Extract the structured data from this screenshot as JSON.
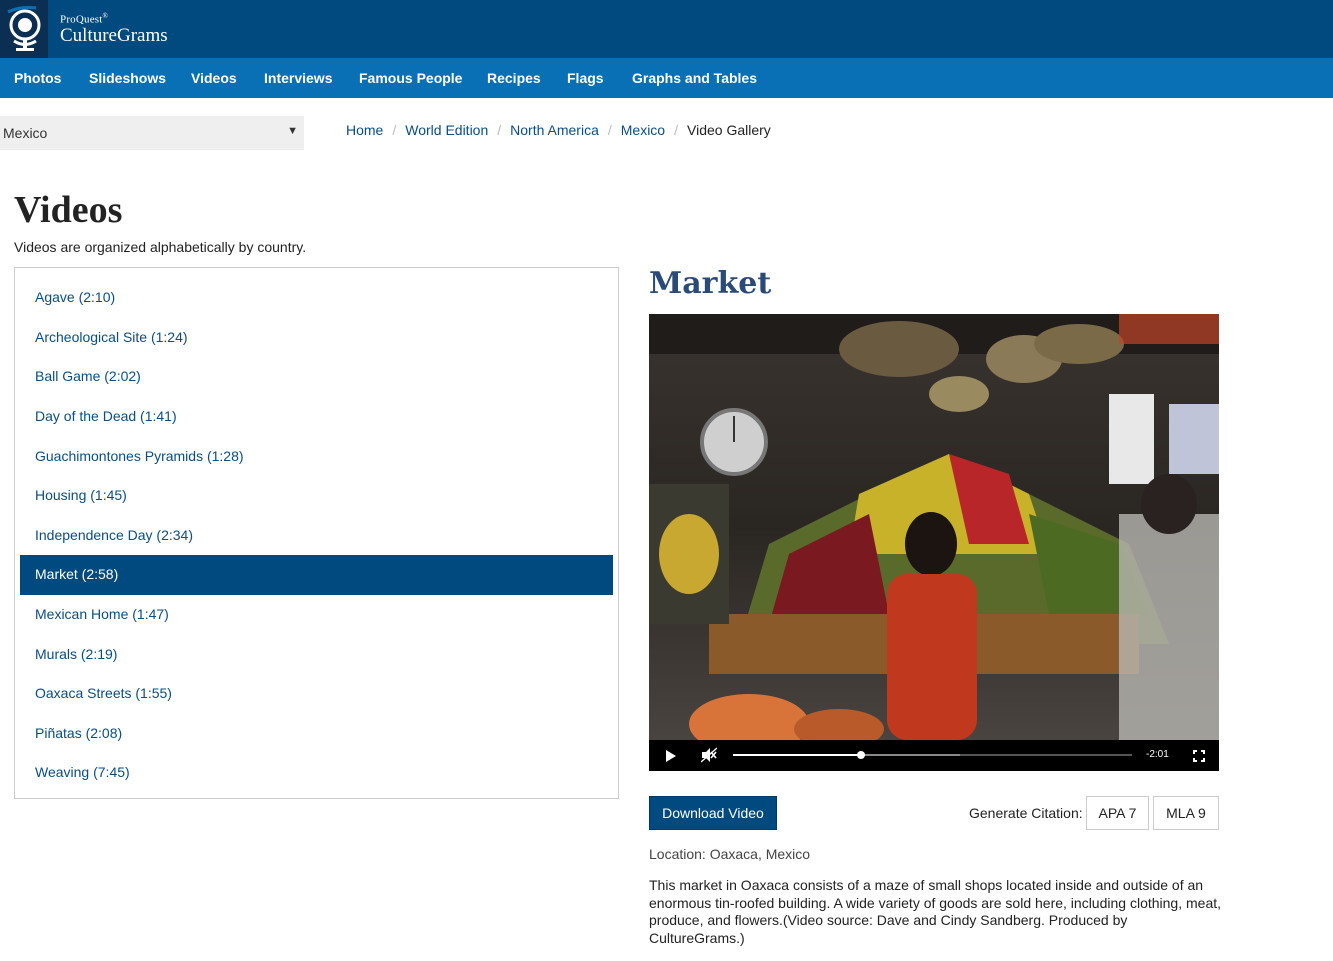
{
  "brand": {
    "small": "ProQuest",
    "mark": "®",
    "big": "CultureGrams"
  },
  "nav": [
    {
      "label": "Photos"
    },
    {
      "label": "Slideshows"
    },
    {
      "label": "Videos"
    },
    {
      "label": "Interviews"
    },
    {
      "label": "Famous People"
    },
    {
      "label": "Recipes"
    },
    {
      "label": "Flags"
    },
    {
      "label": "Graphs and Tables"
    }
  ],
  "country_select": {
    "value": "Mexico"
  },
  "breadcrumb": {
    "items": [
      "Home",
      "World Edition",
      "North America",
      "Mexico"
    ],
    "current": "Video Gallery",
    "separator": "/"
  },
  "page": {
    "title": "Videos",
    "subtitle": "Videos are organized alphabetically by country."
  },
  "videos": [
    {
      "label": "Agave (2:10)",
      "active": false
    },
    {
      "label": "Archeological Site (1:24)",
      "active": false
    },
    {
      "label": "Ball Game (2:02)",
      "active": false
    },
    {
      "label": "Day of the Dead (1:41)",
      "active": false
    },
    {
      "label": "Guachimontones Pyramids (1:28)",
      "active": false
    },
    {
      "label": "Housing (1:45)",
      "active": false
    },
    {
      "label": "Independence Day (2:34)",
      "active": false
    },
    {
      "label": "Market (2:58)",
      "active": true
    },
    {
      "label": "Mexican Home (1:47)",
      "active": false
    },
    {
      "label": "Murals (2:19)",
      "active": false
    },
    {
      "label": "Oaxaca Streets (1:55)",
      "active": false
    },
    {
      "label": "Piñatas (2:08)",
      "active": false
    },
    {
      "label": "Weaving (7:45)",
      "active": false
    }
  ],
  "player": {
    "title": "Market",
    "time_remaining": "-2:01",
    "progress_fraction": 0.32,
    "buffered_fraction": 0.57
  },
  "actions": {
    "download_label": "Download Video",
    "citation_label": "Generate Citation:",
    "apa_label": "APA 7",
    "mla_label": "MLA 9"
  },
  "details": {
    "location": "Location: Oaxaca, Mexico",
    "description": "This market in Oaxaca consists of a maze of small shops located inside and outside of an enormous tin-roofed building. A wide variety of goods are sold here, including clothing, meat, produce, and flowers.(Video source: Dave and Cindy Sandberg. Produced by CultureGrams.)"
  },
  "colors": {
    "header": "#004a80",
    "nav": "#0a70b5",
    "link": "#0a4d85",
    "active": "#004a80",
    "title": "#2a4a78"
  }
}
